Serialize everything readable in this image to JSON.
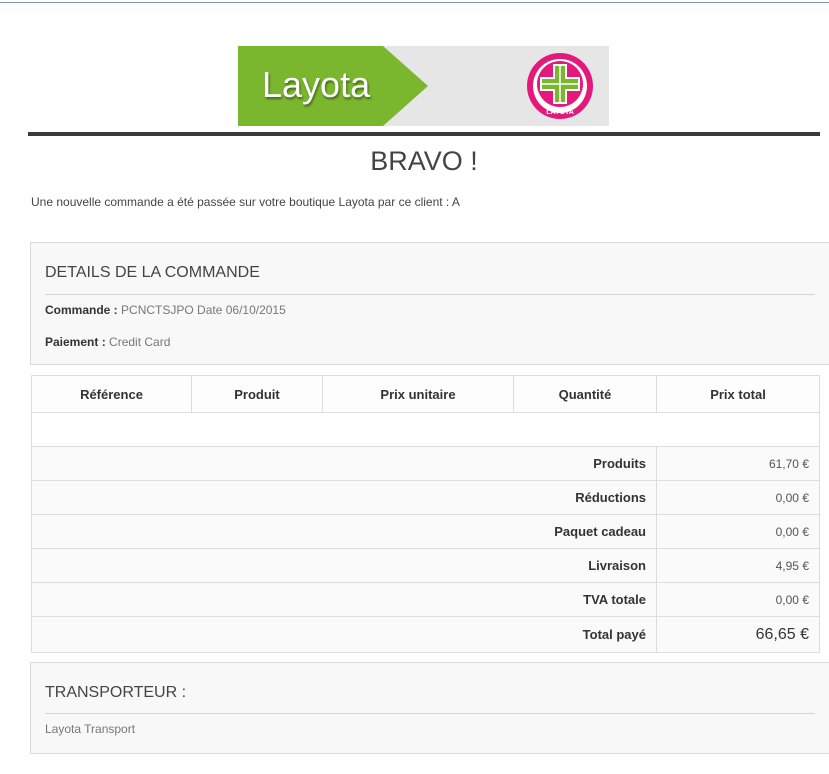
{
  "brand": {
    "name": "Layota",
    "seal_text": "LAYOTA",
    "green": "#7ab62e",
    "seal_pink": "#e3197c"
  },
  "heading": "BRAVO !",
  "intro_text": "Une nouvelle commande a été passée sur votre boutique Layota par ce client : A",
  "details": {
    "title": "DETAILS DE LA COMMANDE",
    "order_label": "Commande :",
    "order_value": "PCNCTSJPO Date 06/10/2015",
    "payment_label": "Paiement :",
    "payment_value": "Credit Card"
  },
  "table": {
    "headers": [
      "Référence",
      "Produit",
      "Prix unitaire",
      "Quantité",
      "Prix total"
    ],
    "summary": [
      {
        "label": "Produits",
        "value": "61,70 €"
      },
      {
        "label": "Réductions",
        "value": "0,00 €"
      },
      {
        "label": "Paquet cadeau",
        "value": "0,00 €"
      },
      {
        "label": "Livraison",
        "value": "4,95 €"
      },
      {
        "label": "TVA totale",
        "value": "0,00 €"
      },
      {
        "label": "Total payé",
        "value": "66,65 €"
      }
    ]
  },
  "carrier": {
    "title": "TRANSPORTEUR :",
    "name": "Layota Transport"
  }
}
